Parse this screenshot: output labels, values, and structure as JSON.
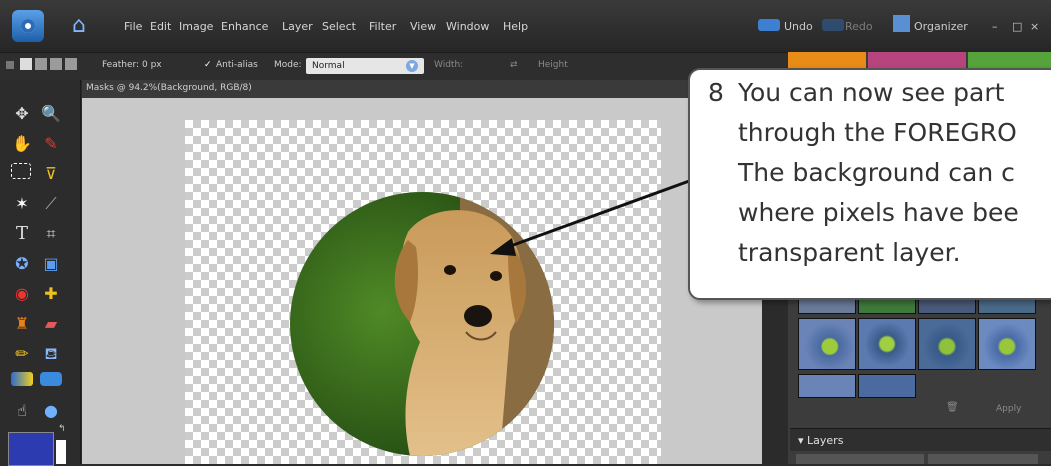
{
  "app": {
    "menu": [
      "File",
      "Edit",
      "Image",
      "Enhance",
      "Layer",
      "Select",
      "Filter",
      "View",
      "Window",
      "Help"
    ],
    "undo": "Undo",
    "redo": "Redo",
    "organizer": "Organizer",
    "minimize": "–",
    "restore": "□",
    "close": "×"
  },
  "options": {
    "feather_label": "Feather:",
    "feather_value": "0 px",
    "antialias": "Anti-alias",
    "mode_label": "Mode:",
    "mode_value": "Normal",
    "width_label": "Width:",
    "height_label": "Height"
  },
  "document": {
    "title": "Masks @ 94.2%(Background, RGB/8)"
  },
  "panel": {
    "apply": "Apply",
    "layers": "Layers"
  },
  "callout": {
    "number": "8",
    "lines": [
      "You can now see part",
      "through the FOREGRO",
      "The background can c",
      "where pixels have bee",
      "transparent layer."
    ]
  },
  "colors": {
    "foreground_swatch": "#2d3bb0",
    "background_swatch": "#ffffff",
    "accent_blue": "#1e5ea8",
    "tab_orange": "#e88b17",
    "tab_magenta": "#b8447e",
    "tab_green": "#55a33a"
  }
}
